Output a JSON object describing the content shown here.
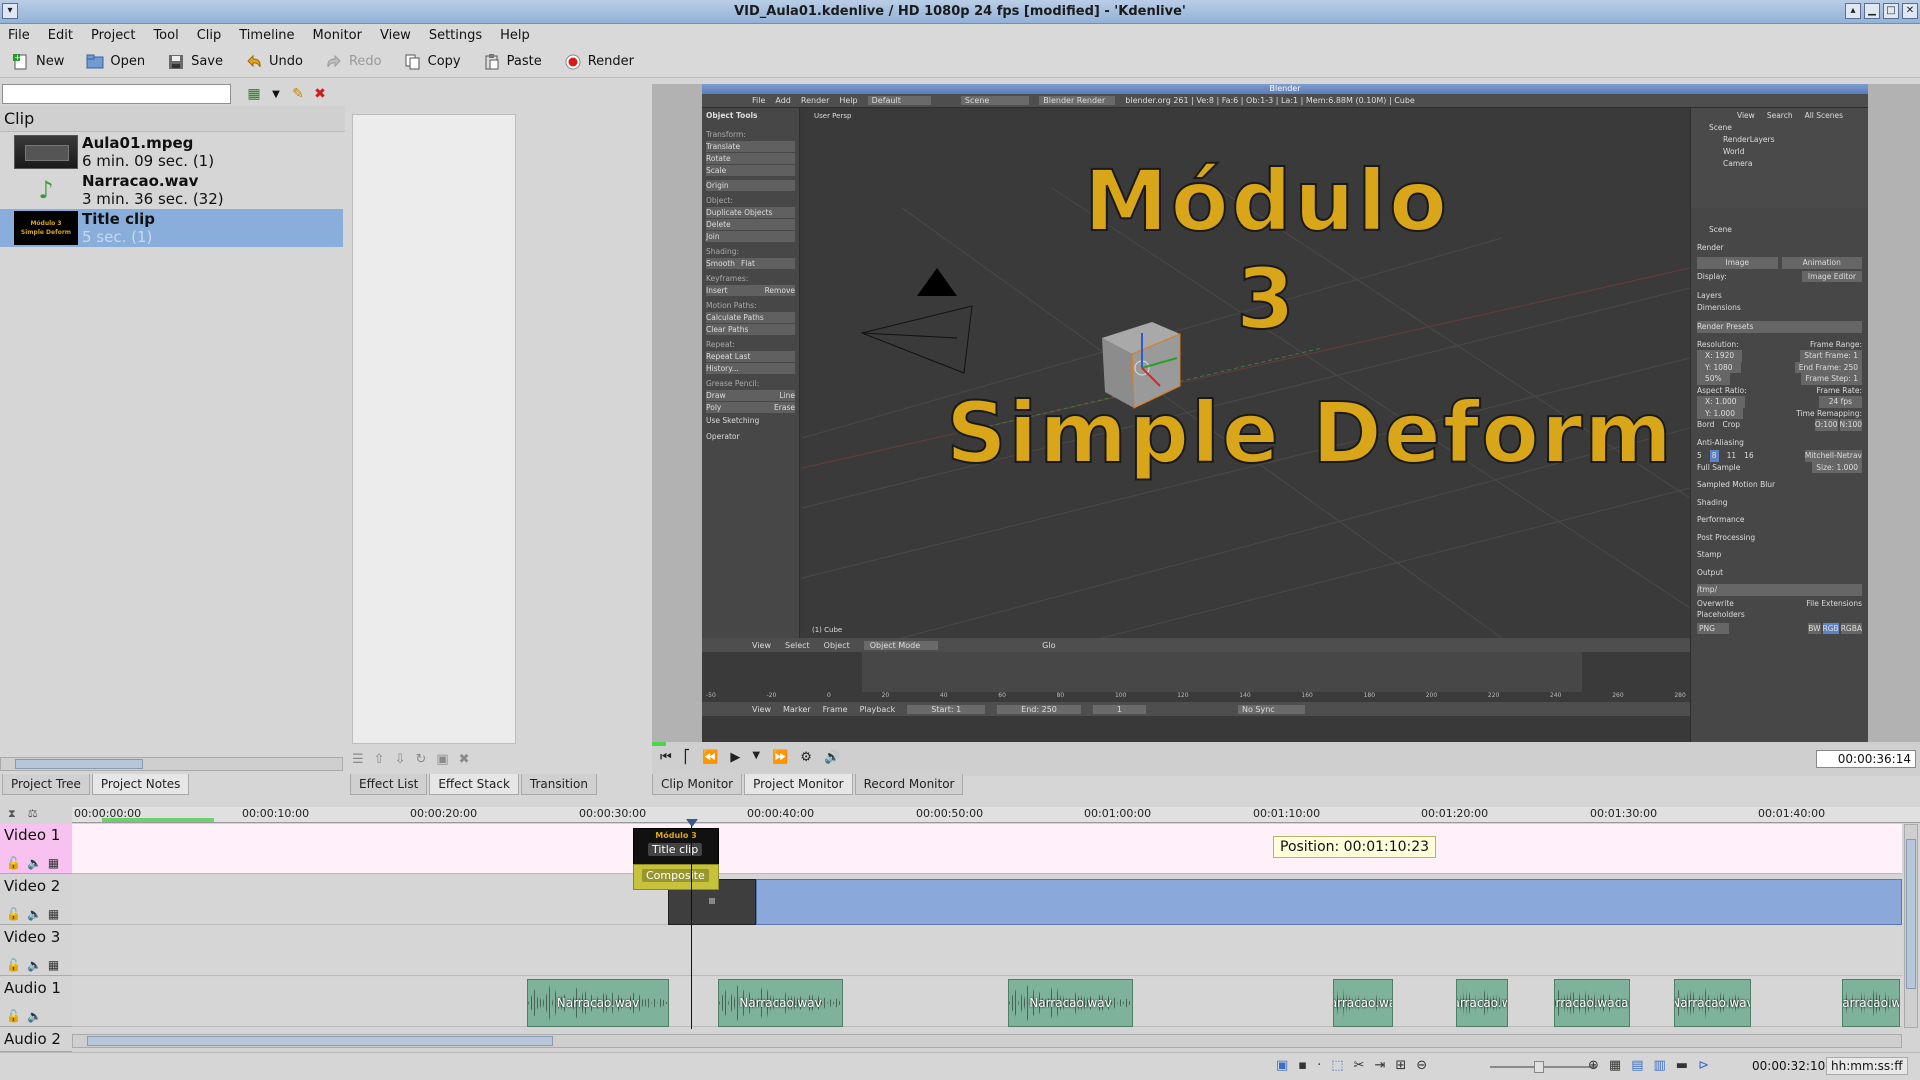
{
  "window": {
    "title": "VID_Aula01.kdenlive / HD 1080p 24 fps [modified] - 'Kdenlive'"
  },
  "menu": [
    "File",
    "Edit",
    "Project",
    "Tool",
    "Clip",
    "Timeline",
    "Monitor",
    "View",
    "Settings",
    "Help"
  ],
  "toolbar": {
    "new": "New",
    "open": "Open",
    "save": "Save",
    "undo": "Undo",
    "redo": "Redo",
    "copy": "Copy",
    "paste": "Paste",
    "render": "Render"
  },
  "project_tree": {
    "header": "Clip",
    "clips": [
      {
        "name": "Aula01.mpeg",
        "duration": "6 min. 09 sec. (1)"
      },
      {
        "name": "Narracao.wav",
        "duration": "3 min. 36 sec. (32)"
      },
      {
        "name": "Title clip",
        "duration": "5 sec. (1)",
        "thumb_top": "Módulo 3",
        "thumb_bottom": "Simple Deform"
      }
    ]
  },
  "left_tabs": [
    "Project Tree",
    "Project Notes"
  ],
  "middle_tabs": [
    "Effect List",
    "Effect Stack",
    "Transition"
  ],
  "monitor_tabs": [
    "Clip Monitor",
    "Project Monitor",
    "Record Monitor"
  ],
  "monitor": {
    "timecode": "00:00:36:14",
    "overlay_title": "Módulo 3",
    "overlay_subtitle": "Simple Deform",
    "blender": {
      "title": "Blender",
      "header_items": [
        "File",
        "Add",
        "Render",
        "Help",
        "Default",
        "Scene",
        "Blender Render",
        "blender.org 261 | Ve:8 | Fa:6 | Ob:1-3 | La:1 | Mem:6.88M (0.10M) | Cube"
      ],
      "view_label": "User Persp",
      "object_label": "(1) Cube",
      "tools": {
        "header": "Object Tools",
        "transform_label": "Transform:",
        "transform": [
          "Translate",
          "Rotate",
          "Scale"
        ],
        "origin": "Origin",
        "object_label": "Object:",
        "object": [
          "Duplicate Objects",
          "Delete",
          "Join"
        ],
        "shading_label": "Shading:",
        "shading": [
          "Smooth",
          "Flat"
        ],
        "keyframes_label": "Keyframes:",
        "keyframes": [
          "Insert",
          "Remove"
        ],
        "motion_label": "Motion Paths:",
        "motion": [
          "Calculate Paths",
          "Clear Paths"
        ],
        "repeat_label": "Repeat:",
        "repeat": [
          "Repeat Last",
          "History..."
        ],
        "grease_label": "Grease Pencil:",
        "grease": [
          "Draw",
          "Line",
          "Poly",
          "Erase"
        ],
        "sketch": "Use Sketching",
        "operator": "Operator"
      },
      "outliner": {
        "tabs": [
          "View",
          "Search",
          "All Scenes"
        ],
        "items": [
          "Scene",
          "RenderLayers",
          "World",
          "Camera"
        ]
      },
      "properties": {
        "scene_label": "Scene",
        "render_label": "Render",
        "image_btn": "Image",
        "animation_btn": "Animation",
        "display_label": "Display:",
        "display_value": "Image Editor",
        "layers": "Layers",
        "dimensions": "Dimensions",
        "presets": "Render Presets",
        "resolution_label": "Resolution:",
        "res_x": "X: 1920",
        "res_y": "Y: 1080",
        "res_pct": "50%",
        "frame_range_label": "Frame Range:",
        "start_frame": "Start Frame: 1",
        "end_frame": "End Frame: 250",
        "frame_step": "Frame Step: 1",
        "aspect_label": "Aspect Ratio:",
        "aspect_x": "X: 1.000",
        "aspect_y": "Y: 1.000",
        "frame_rate_label": "Frame Rate:",
        "frame_rate": "24 fps",
        "time_remap": "Time Remapping:",
        "remap_old": "O:100",
        "remap_new": "N:100",
        "border": "Bord",
        "crop": "Crop",
        "anti_aliasing": "Anti-Aliasing",
        "aa_samples": [
          "5",
          "8",
          "11",
          "16"
        ],
        "aa_filter": "Mitchell-Netrav",
        "full_sample": "Full Sample",
        "size": "Size: 1.000",
        "sections": [
          "Sampled Motion Blur",
          "Shading",
          "Performance",
          "Post Processing",
          "Stamp",
          "Output"
        ],
        "output_path": "/tmp/",
        "overwrite": "Overwrite",
        "file_ext": "File Extensions",
        "placeholders": "Placeholders",
        "format": "PNG",
        "color_modes": [
          "BW",
          "RGB",
          "RGBA"
        ]
      },
      "view3d_menu": [
        "View",
        "Select",
        "Object",
        "Object Mode",
        "Glo"
      ],
      "timeline_menu": [
        "View",
        "Marker",
        "Frame",
        "Playback",
        "Start: 1",
        "End: 250",
        "1",
        "No Sync"
      ],
      "timeline_ticks": [
        "-50",
        "-20",
        "0",
        "20",
        "40",
        "60",
        "80",
        "100",
        "120",
        "140",
        "160",
        "180",
        "200",
        "220",
        "240",
        "260",
        "280"
      ]
    }
  },
  "timeline": {
    "ruler": [
      "00:00:00:00",
      "00:00:10:00",
      "00:00:20:00",
      "00:00:30:00",
      "00:00:40:00",
      "00:00:50:00",
      "00:01:00:00",
      "00:01:10:00",
      "00:01:20:00",
      "00:01:30:00",
      "00:01:40:00"
    ],
    "tracks": [
      {
        "name": "Video 1",
        "type": "video"
      },
      {
        "name": "Video 2",
        "type": "video"
      },
      {
        "name": "Video 3",
        "type": "video"
      },
      {
        "name": "Audio 1",
        "type": "audio"
      },
      {
        "name": "Audio 2",
        "type": "audio"
      }
    ],
    "title_clip_label": "Title clip",
    "title_clip_thumb": "Módulo 3",
    "composite_label": "Composite",
    "position_tooltip": "Position: 00:01:10:23",
    "audio_clips": [
      "Narracao.wav",
      "Narracao.wav",
      "Narracao.wav",
      "arracao.wa",
      "arracao.w",
      "arracao.wacao",
      "Narracao.wav",
      "Narracao.wa"
    ]
  },
  "statusbar": {
    "timecode": "00:00:32:10",
    "format": "hh:mm:ss:ff"
  },
  "colors": {
    "title_text": "#d9a519",
    "selection": "#8aaedc",
    "video1_bg": "#fff0fa",
    "video2_clip": "#8aa8da",
    "audio_clip": "#7fb29a"
  }
}
